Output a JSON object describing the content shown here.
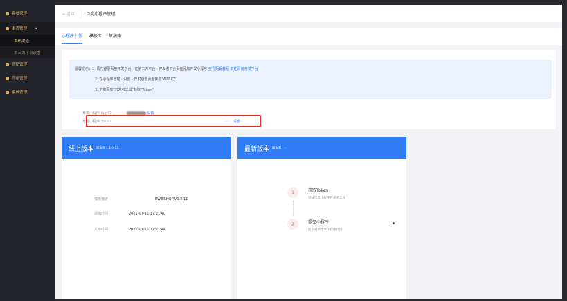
{
  "sidebar": {
    "items": [
      {
        "label": "套餐管理"
      },
      {
        "label": "渠道管理"
      },
      {
        "label": "营销管理"
      },
      {
        "label": "应用管理"
      },
      {
        "label": "模板管理"
      }
    ],
    "sub_items": [
      {
        "label": "发布渠道"
      },
      {
        "label": "第三方平台设置"
      }
    ]
  },
  "header": {
    "back": "← 返回",
    "title": "百度小程序管理"
  },
  "tabs": [
    {
      "label": "小程序上传"
    },
    {
      "label": "模板库"
    },
    {
      "label": "草稿箱"
    }
  ],
  "tips": {
    "prefix": "温馨提示：",
    "line1": "1. 请先登录百度开发平台，在第三方平台 - 开发者平台页面添加开发小程序",
    "link1": "查看配置教程",
    "link2": "前往百度开发平台",
    "line2": "2. 在小程序管理 - 设置 - 开发设置页面获取\"APP ID\"",
    "line3": "3. 下载百度\"开发者工具\"获取\"Token\""
  },
  "fields": {
    "appid_label": "开发小程序 AppID",
    "token_label": "开发小程序 Token",
    "set": "设置",
    "ellipsis": "..."
  },
  "online": {
    "title": "线上版本",
    "version": "版本号：1.0.11",
    "rows": [
      {
        "k": "模板描述",
        "v": "EWEISHOP-V1.0.11"
      },
      {
        "k": "添加时间",
        "v": "2021-07-16 17:21:40"
      },
      {
        "k": "发布时间",
        "v": "2021-07-16 17:21:44"
      }
    ]
  },
  "latest": {
    "title": "最新版本",
    "version": "版本号：-",
    "steps": [
      {
        "n": "1",
        "title": "获取Token",
        "desc": "登陆百度小程序开发者工具"
      },
      {
        "n": "2",
        "title": "提交小程序",
        "desc": "提交最新版本小程序代码"
      }
    ]
  }
}
